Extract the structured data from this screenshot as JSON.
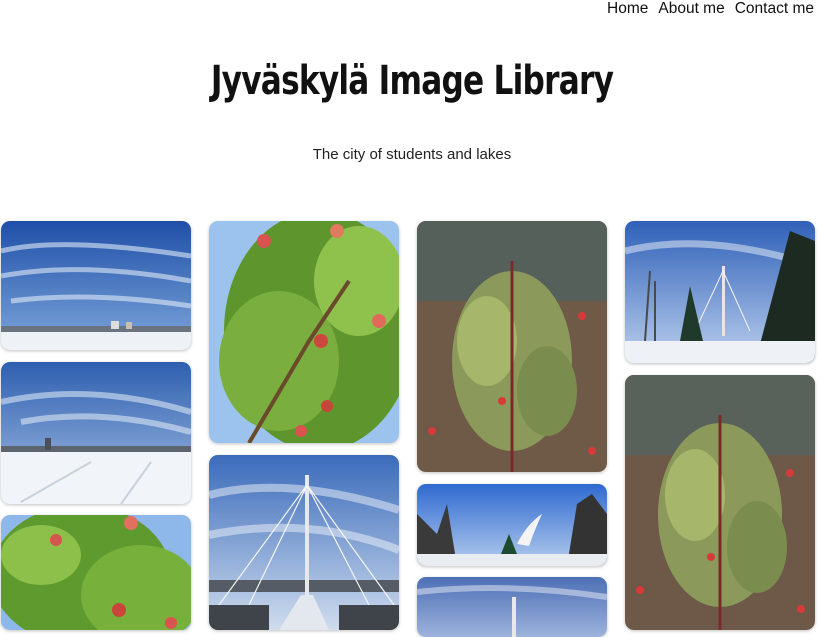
{
  "nav": {
    "home": "Home",
    "about": "About me",
    "contact": "Contact me"
  },
  "header": {
    "title": "Jyväskylä Image Library",
    "subtitle": "The city of students and lakes"
  }
}
